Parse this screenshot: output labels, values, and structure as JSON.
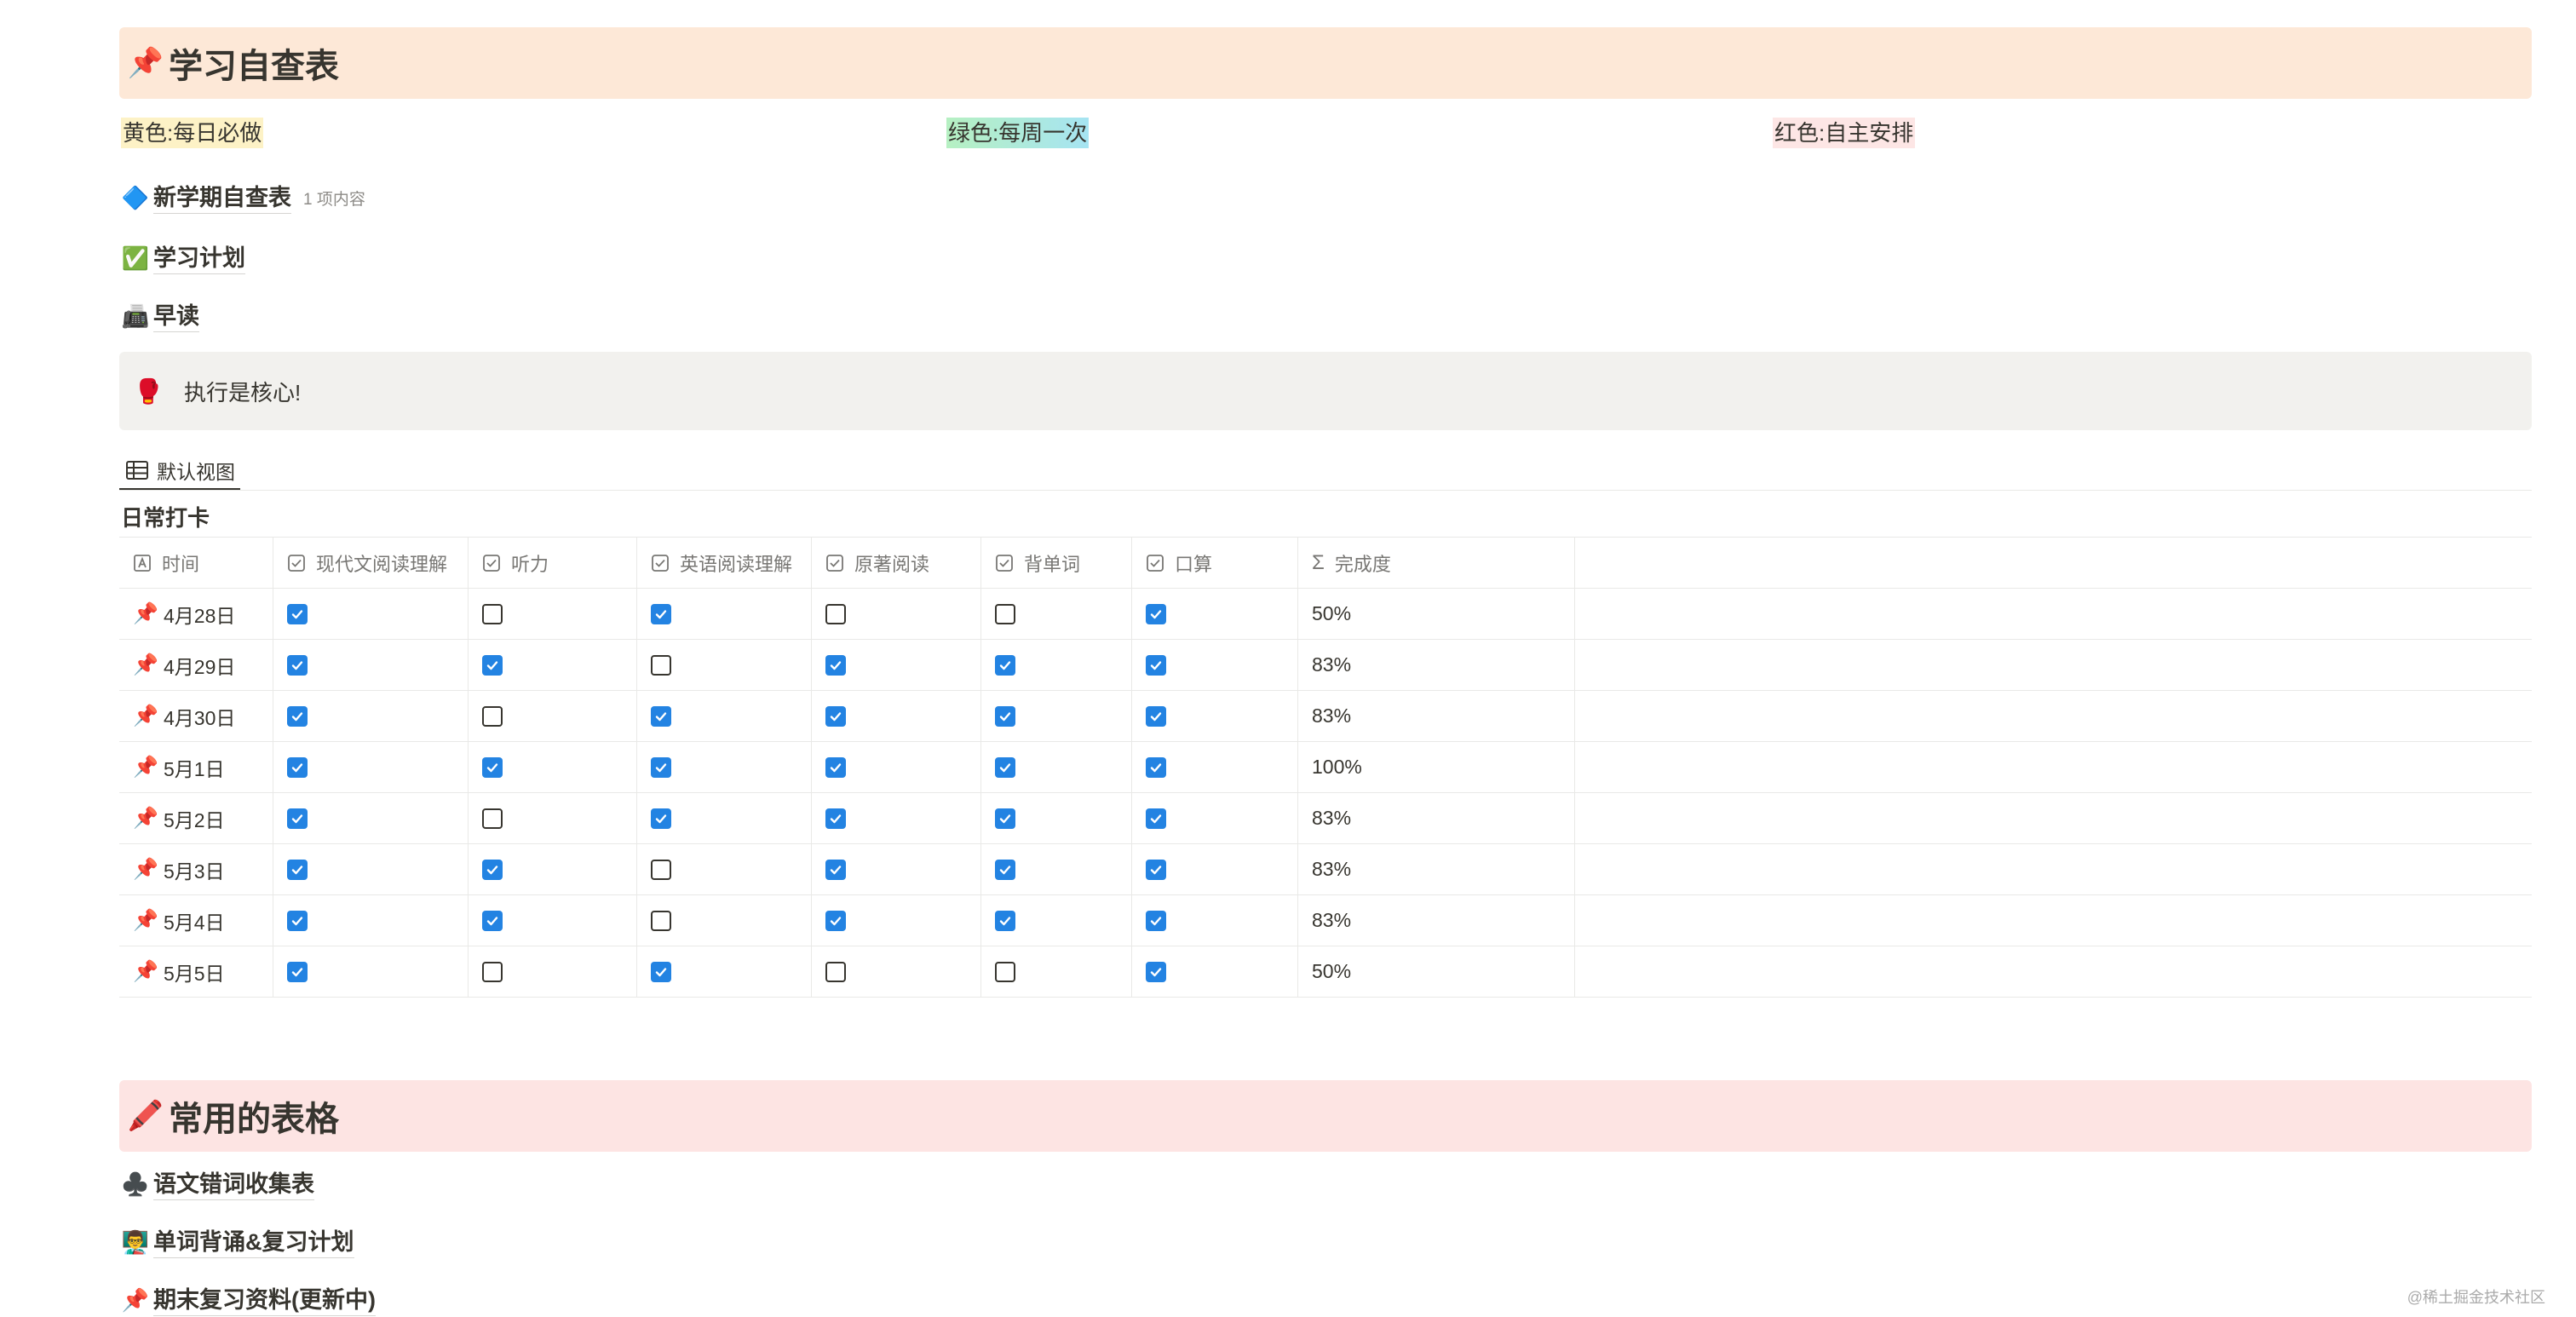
{
  "section1": {
    "icon": "📌",
    "title": "学习自查表"
  },
  "legend": {
    "yellow": "黄色:每日必做",
    "green": "绿色:每周一次",
    "red": "红色:自主安排"
  },
  "links1": [
    {
      "icon": "🔷",
      "text": "新学期自查表",
      "count": "1 项内容"
    },
    {
      "icon": "✅",
      "text": "学习计划"
    },
    {
      "icon": "📠",
      "text": "早读"
    }
  ],
  "callout": {
    "icon": "🥊",
    "text": "执行是核心!"
  },
  "view": {
    "tab_label": "默认视图"
  },
  "database": {
    "title": "日常打卡",
    "columns": [
      {
        "label": "时间",
        "icon": "title-icon"
      },
      {
        "label": "现代文阅读理解",
        "icon": "checkbox-icon"
      },
      {
        "label": "听力",
        "icon": "checkbox-icon"
      },
      {
        "label": "英语阅读理解",
        "icon": "checkbox-icon"
      },
      {
        "label": "原著阅读",
        "icon": "checkbox-icon"
      },
      {
        "label": "背单词",
        "icon": "checkbox-icon"
      },
      {
        "label": "口算",
        "icon": "checkbox-icon"
      },
      {
        "label": "完成度",
        "icon": "sigma-icon"
      }
    ],
    "row_icon": "📌",
    "rows": [
      {
        "date": "4月28日",
        "checks": [
          true,
          false,
          true,
          false,
          false,
          true
        ],
        "completion": "50%"
      },
      {
        "date": "4月29日",
        "checks": [
          true,
          true,
          false,
          true,
          true,
          true
        ],
        "completion": "83%"
      },
      {
        "date": "4月30日",
        "checks": [
          true,
          false,
          true,
          true,
          true,
          true
        ],
        "completion": "83%"
      },
      {
        "date": "5月1日",
        "checks": [
          true,
          true,
          true,
          true,
          true,
          true
        ],
        "completion": "100%"
      },
      {
        "date": "5月2日",
        "checks": [
          true,
          false,
          true,
          true,
          true,
          true
        ],
        "completion": "83%"
      },
      {
        "date": "5月3日",
        "checks": [
          true,
          true,
          false,
          true,
          true,
          true
        ],
        "completion": "83%"
      },
      {
        "date": "5月4日",
        "checks": [
          true,
          true,
          false,
          true,
          true,
          true
        ],
        "completion": "83%"
      },
      {
        "date": "5月5日",
        "checks": [
          true,
          false,
          true,
          false,
          false,
          true
        ],
        "completion": "50%"
      }
    ]
  },
  "section2": {
    "icon": "🖍️",
    "title": "常用的表格"
  },
  "links2": [
    {
      "icon": "♣️",
      "text": "语文错词收集表"
    },
    {
      "icon": "👨‍🏫",
      "text": "单词背诵&复习计划"
    },
    {
      "icon": "📌",
      "text": "期末复习资料(更新中)"
    }
  ],
  "watermark": "@稀土掘金技术社区"
}
